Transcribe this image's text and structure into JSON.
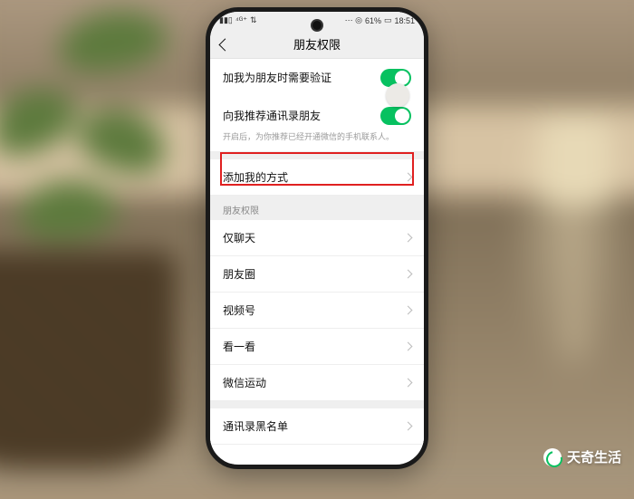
{
  "status": {
    "left_signal": "▮▮▯",
    "left_net": "⁴ᴳ⁺",
    "left_extra": "⇅",
    "right_icons": "⋯ ◎",
    "battery": "61%",
    "battery_icon": "▭",
    "time": "18:51"
  },
  "nav": {
    "title": "朋友权限"
  },
  "rows": {
    "verify": "加我为朋友时需要验证",
    "recommend": "向我推荐通讯录朋友",
    "recommend_desc": "开启后，为你推荐已经开通微信的手机联系人。",
    "add_way": "添加我的方式",
    "section_perm": "朋友权限",
    "chat_only": "仅聊天",
    "moments": "朋友圈",
    "channels": "视频号",
    "top_stories": "看一看",
    "werun": "微信运动",
    "blacklist": "通讯录黑名单"
  },
  "watermark": "天奇生活"
}
